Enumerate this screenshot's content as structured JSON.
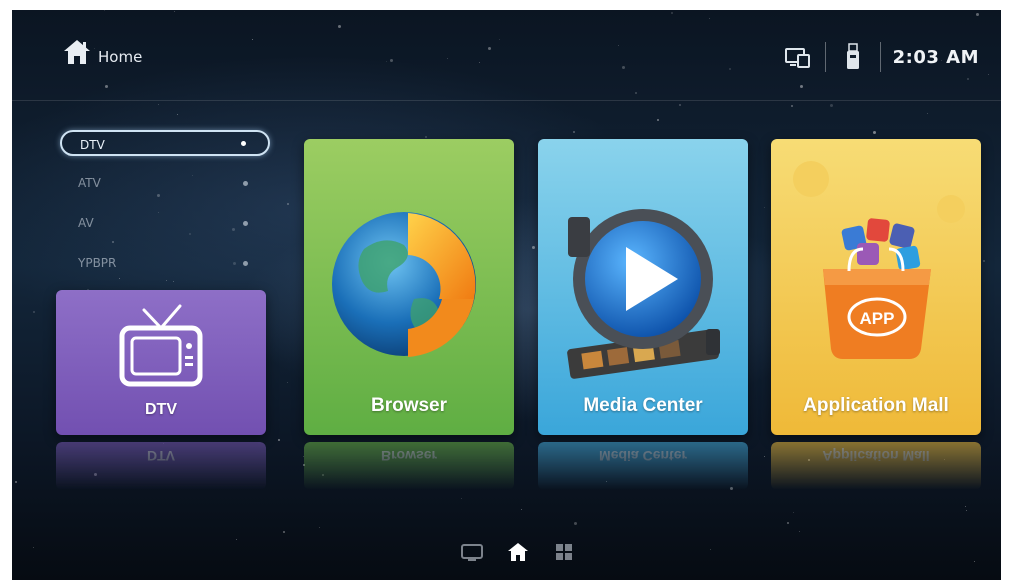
{
  "header": {
    "home_label": "Home",
    "time": "2:03 AM",
    "icons": [
      "home-icon",
      "screen-mirror-icon",
      "usb-drive-icon"
    ]
  },
  "sources": {
    "items": [
      {
        "label": "DTV",
        "selected": true
      },
      {
        "label": "ATV",
        "selected": false
      },
      {
        "label": "AV",
        "selected": false
      },
      {
        "label": "YPBPR",
        "selected": false
      }
    ]
  },
  "tiles": {
    "dtv": {
      "label": "DTV",
      "icon": "tv-icon",
      "color": "#7f5fbb"
    },
    "browser": {
      "label": "Browser",
      "icon": "globe-icon",
      "color": "#74b84c"
    },
    "media_center": {
      "label": "Media Center",
      "icon": "play-film-icon",
      "color": "#4fb1df"
    },
    "application_mall": {
      "label": "Application Mall",
      "icon": "app-bag-icon",
      "badge": "APP",
      "color": "#f2c445"
    }
  },
  "bottom_nav": {
    "items": [
      "tv-mode-icon",
      "home-icon",
      "apps-grid-icon"
    ],
    "active": "home-icon"
  }
}
